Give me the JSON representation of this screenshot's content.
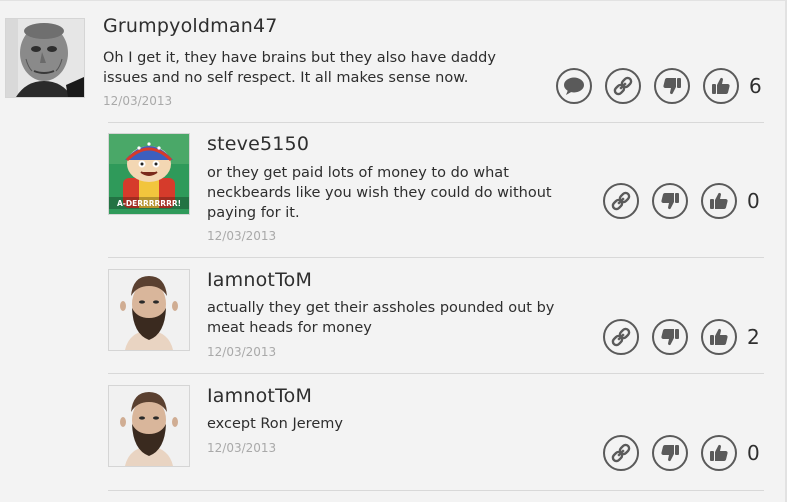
{
  "comments": [
    {
      "username": "Grumpyoldman47",
      "text": "Oh I get it, they have brains but they also have daddy issues and no self respect. It all makes sense now.",
      "date": "12/03/2013",
      "likes": "6"
    },
    {
      "username": "steve5150",
      "text": "or they get paid lots of money to do what neckbeards like you wish they could do without paying for it.",
      "date": "12/03/2013",
      "likes": "0",
      "avatar_caption": "A-DERRRRRRR!"
    },
    {
      "username": "IamnotToM",
      "text": "actually they get their assholes pounded out by meat heads for money",
      "date": "12/03/2013",
      "likes": "2"
    },
    {
      "username": "IamnotToM",
      "text": "except Ron Jeremy",
      "date": "12/03/2013",
      "likes": "0"
    }
  ],
  "icons": {
    "reply": "speech-bubble-icon",
    "link": "chain-link-icon",
    "dislike": "thumbs-down-icon",
    "like": "thumbs-up-icon"
  },
  "colors": {
    "icon": "#5a5a5a",
    "date": "#a9a9a9",
    "background": "#f3f3f3"
  }
}
